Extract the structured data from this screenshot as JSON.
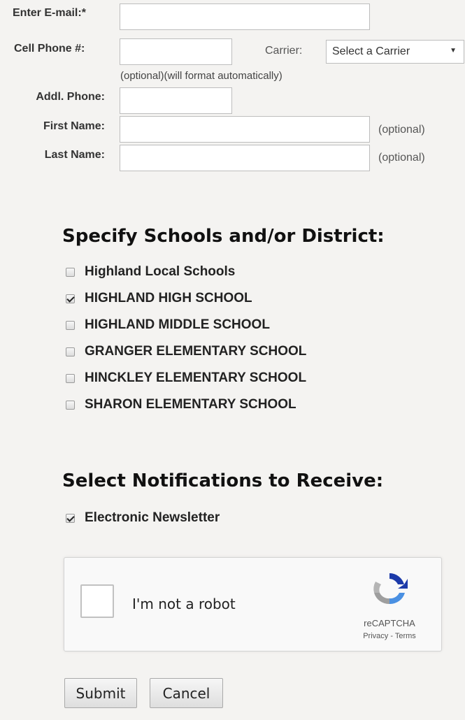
{
  "form": {
    "email_label": "Enter E-mail:*",
    "cell_label": "Cell Phone #:",
    "carrier_label": "Carrier:",
    "carrier_value": "Select a Carrier",
    "cell_hint": "(optional)(will format automatically)",
    "addl_label": "Addl. Phone:",
    "first_label": "First Name:",
    "last_label": "Last Name:",
    "optional_text": "(optional)"
  },
  "schools": {
    "heading": "Specify Schools and/or District:",
    "items": [
      {
        "label": "Highland Local Schools",
        "checked": false
      },
      {
        "label": "HIGHLAND HIGH SCHOOL",
        "checked": true
      },
      {
        "label": "HIGHLAND MIDDLE SCHOOL",
        "checked": false
      },
      {
        "label": "GRANGER ELEMENTARY SCHOOL",
        "checked": false
      },
      {
        "label": "HINCKLEY ELEMENTARY SCHOOL",
        "checked": false
      },
      {
        "label": "SHARON ELEMENTARY SCHOOL",
        "checked": false
      }
    ]
  },
  "notifications": {
    "heading": "Select Notifications to Receive:",
    "items": [
      {
        "label": "Electronic Newsletter",
        "checked": true
      }
    ]
  },
  "captcha": {
    "text": "I'm not a robot",
    "brand": "reCAPTCHA",
    "privacy": "Privacy",
    "separator": " - ",
    "terms": "Terms"
  },
  "buttons": {
    "submit": "Submit",
    "cancel": "Cancel"
  }
}
